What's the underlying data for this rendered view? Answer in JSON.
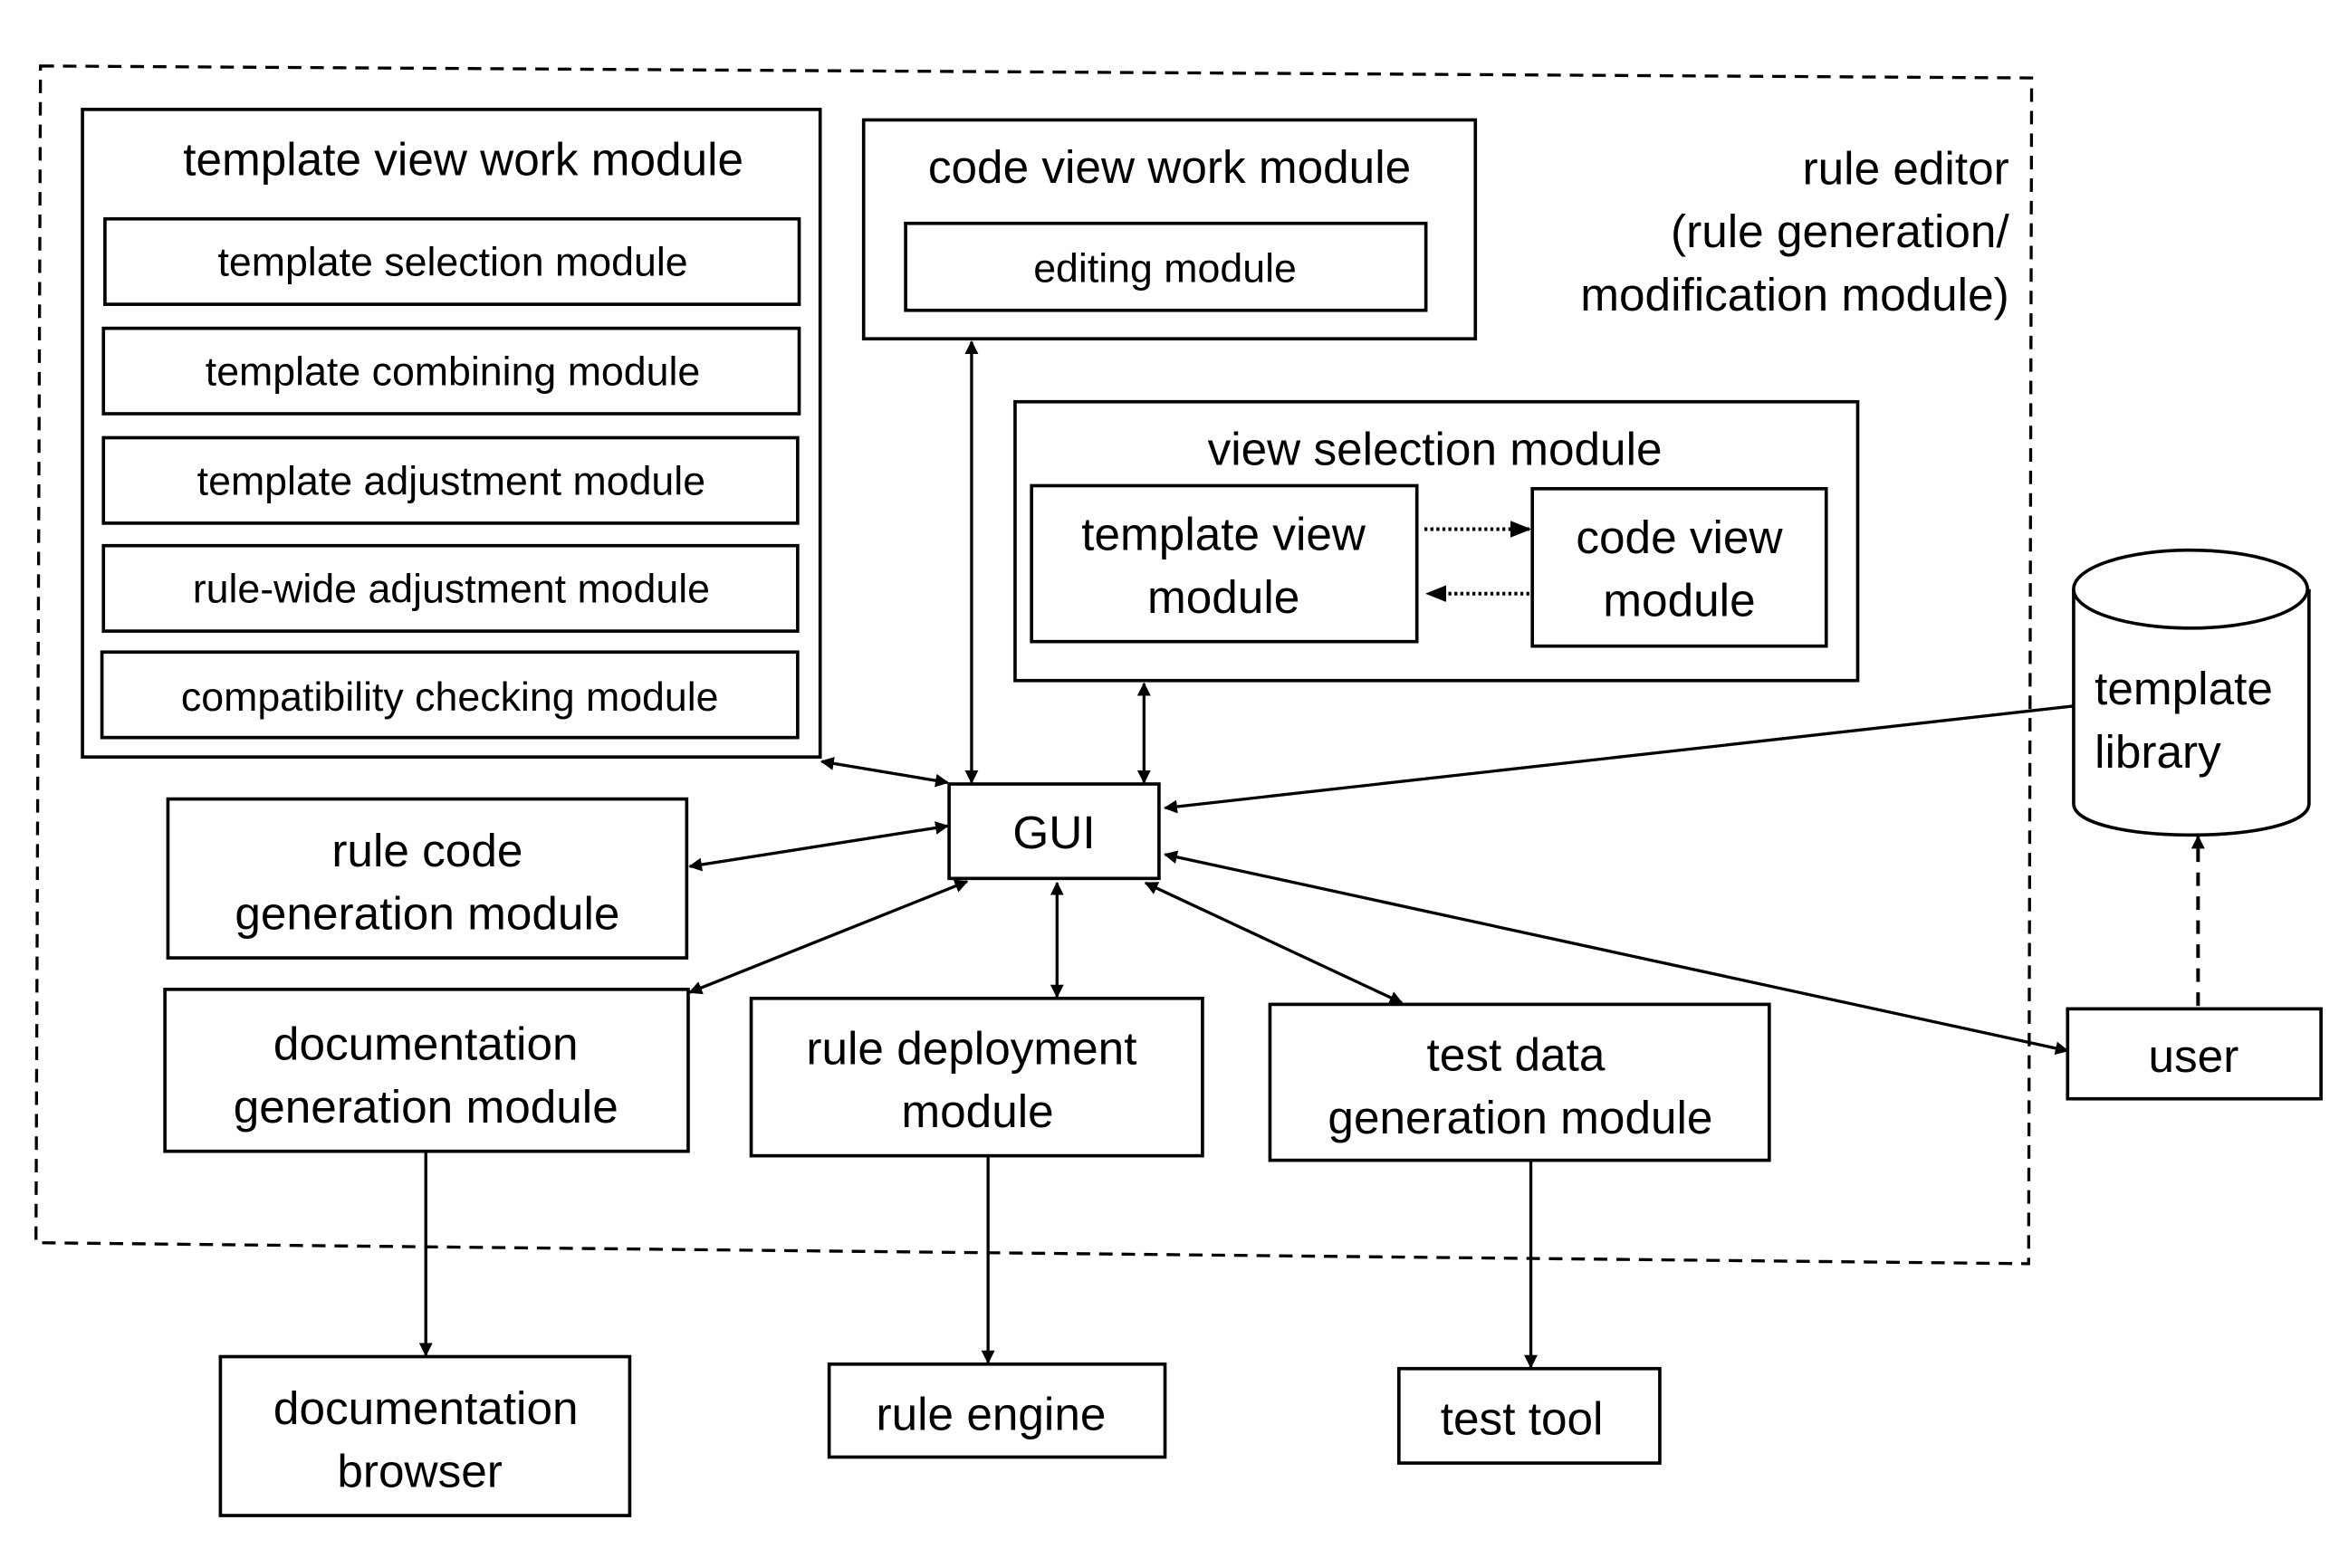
{
  "diagram": {
    "boundary": {
      "title_lines": [
        "rule editor",
        "(rule generation/",
        "modification module)"
      ]
    },
    "template_view_work_module": {
      "title": "template view work module",
      "submodules": [
        "template selection module",
        "template combining module",
        "template adjustment module",
        "rule-wide adjustment module",
        "compatibility checking module"
      ]
    },
    "code_view_work_module": {
      "title": "code view work module",
      "submodules": [
        "editing module"
      ]
    },
    "view_selection_module": {
      "title": "view selection module",
      "template_view_module": [
        "template view",
        "module"
      ],
      "code_view_module": [
        "code view",
        "module"
      ]
    },
    "gui": {
      "label": "GUI"
    },
    "rule_code_generation_module": [
      "rule code",
      "generation module"
    ],
    "documentation_generation_module": [
      "documentation",
      "generation module"
    ],
    "rule_deployment_module": [
      "rule deployment",
      "module"
    ],
    "test_data_generation_module": [
      "test data",
      "generation module"
    ],
    "template_library": [
      "template",
      "library"
    ],
    "user": {
      "label": "user"
    },
    "documentation_browser": [
      "documentation",
      "browser"
    ],
    "rule_engine": {
      "label": "rule engine"
    },
    "test_tool": {
      "label": "test tool"
    },
    "connections": [
      {
        "from": "template view work module",
        "to": "GUI",
        "type": "bidirectional"
      },
      {
        "from": "code view work module",
        "to": "GUI",
        "type": "bidirectional"
      },
      {
        "from": "view selection module",
        "to": "GUI",
        "type": "bidirectional"
      },
      {
        "from": "template library",
        "to": "GUI",
        "type": "directed"
      },
      {
        "from": "rule code generation module",
        "to": "GUI",
        "type": "bidirectional"
      },
      {
        "from": "documentation generation module",
        "to": "GUI",
        "type": "bidirectional"
      },
      {
        "from": "rule deployment module",
        "to": "GUI",
        "type": "bidirectional"
      },
      {
        "from": "test data generation module",
        "to": "GUI",
        "type": "bidirectional"
      },
      {
        "from": "user",
        "to": "GUI",
        "type": "bidirectional"
      },
      {
        "from": "user",
        "to": "template library",
        "type": "dashed-directed"
      },
      {
        "from": "template view module",
        "to": "code view module",
        "type": "dotted-directed"
      },
      {
        "from": "code view module",
        "to": "template view module",
        "type": "dotted-directed"
      },
      {
        "from": "documentation generation module",
        "to": "documentation browser",
        "type": "directed"
      },
      {
        "from": "rule deployment module",
        "to": "rule engine",
        "type": "directed"
      },
      {
        "from": "test data generation module",
        "to": "test tool",
        "type": "directed"
      }
    ]
  }
}
